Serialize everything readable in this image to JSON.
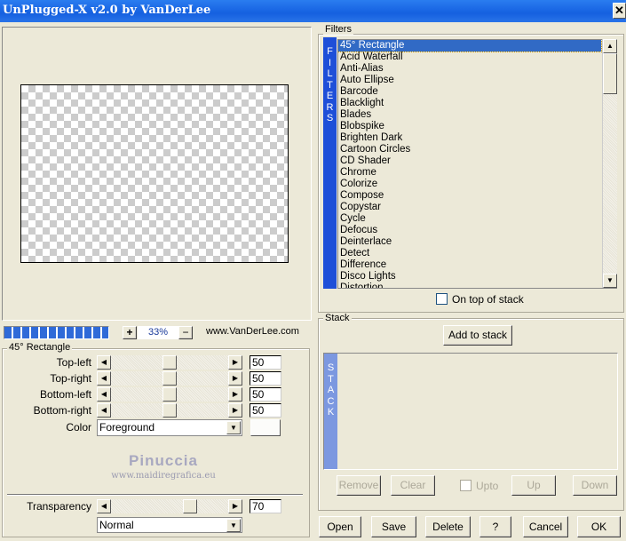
{
  "window": {
    "title": "UnPlugged-X v2.0 by VanDerLee",
    "close_icon": "close-icon"
  },
  "preview": {
    "zoom": "33%",
    "zoom_in": "+",
    "zoom_out": "−",
    "progress_percent": 100,
    "website": "www.VanDerLee.com"
  },
  "params": {
    "group": "45° Rectangle",
    "sliders": [
      {
        "label": "Top-left",
        "value": "50",
        "level": 50
      },
      {
        "label": "Top-right",
        "value": "50",
        "level": 50
      },
      {
        "label": "Bottom-left",
        "value": "50",
        "level": 50
      },
      {
        "label": "Bottom-right",
        "value": "50",
        "level": 50
      }
    ],
    "color_label": "Color",
    "color_value": "Foreground",
    "watermark": {
      "name": "Pinuccia",
      "url": "www.maidiregrafica.eu"
    },
    "transparency_label": "Transparency",
    "transparency_value": "70",
    "transparency_level": 70,
    "blend_mode": "Normal"
  },
  "filters": {
    "title": "Filters",
    "strip": "FILTERS",
    "selected": "45° Rectangle",
    "items": [
      "45° Rectangle",
      "Acid Waterfall",
      "Anti-Alias",
      "Auto Ellipse",
      "Barcode",
      "Blacklight",
      "Blades",
      "Blobspike",
      "Brighten Dark",
      "Cartoon Circles",
      "CD Shader",
      "Chrome",
      "Colorize",
      "Compose",
      "Copystar",
      "Cycle",
      "Defocus",
      "Deinterlace",
      "Detect",
      "Difference",
      "Disco Lights",
      "Distortion"
    ],
    "on_top_label": "On top of stack"
  },
  "stack": {
    "title": "Stack",
    "add": "Add to stack",
    "strip": "STACK",
    "remove": "Remove",
    "clear": "Clear",
    "upto": "Upto",
    "up": "Up",
    "down": "Down"
  },
  "footer": {
    "open": "Open",
    "save": "Save",
    "delete": "Delete",
    "help": "?",
    "cancel": "Cancel",
    "ok": "OK"
  }
}
